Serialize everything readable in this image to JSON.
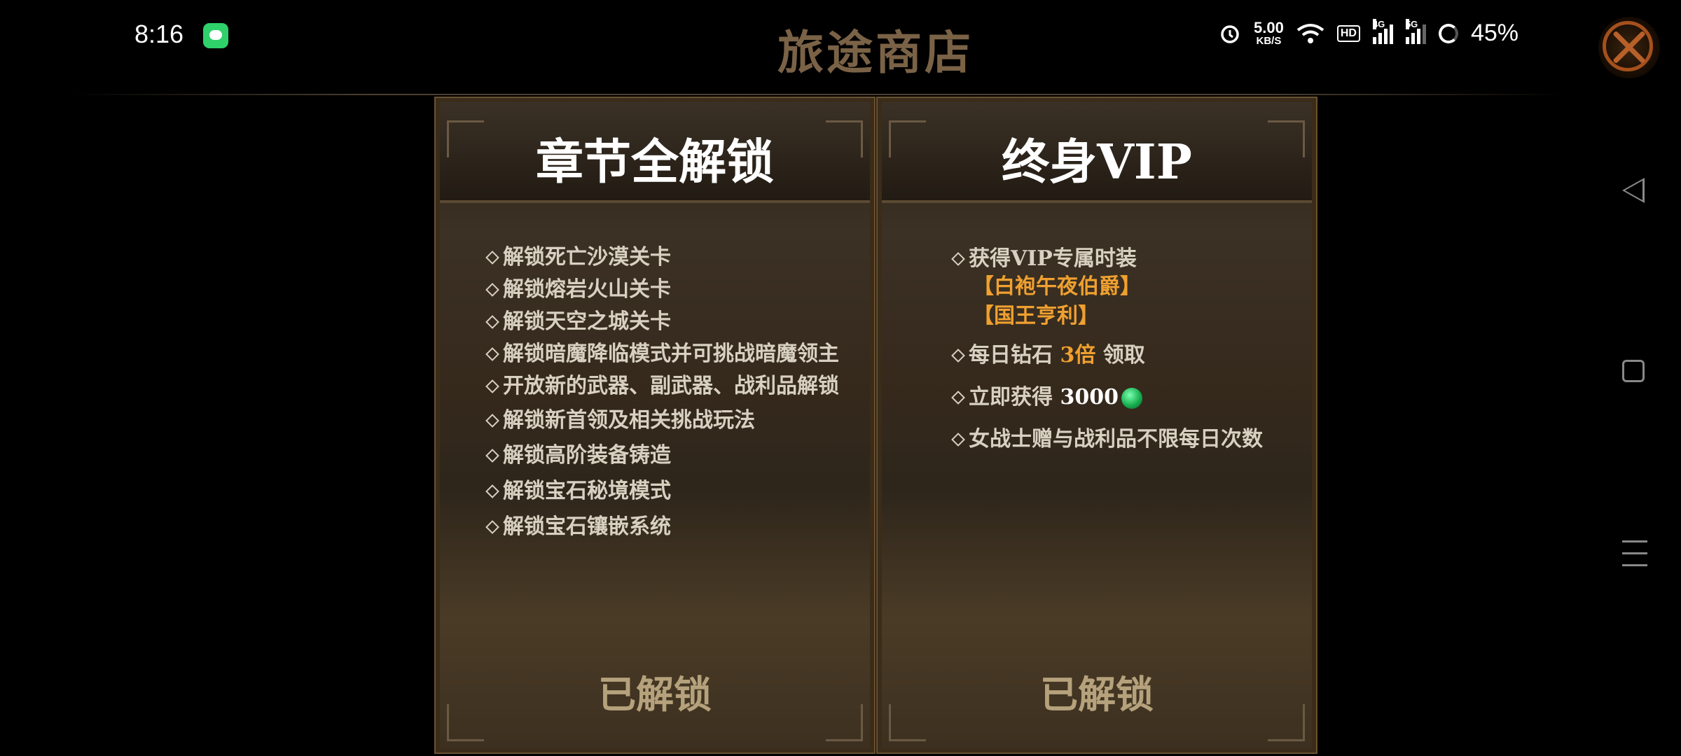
{
  "status_bar": {
    "time": "8:16",
    "net_speed_value": "5.00",
    "net_speed_unit": "KB/S",
    "hd_label": "HD",
    "sim1_label": "4G",
    "sim2_label": "5G",
    "battery": "45%"
  },
  "header": {
    "title": "旅途商店"
  },
  "cards": [
    {
      "title": "章节全解锁",
      "features": [
        "解锁死亡沙漠关卡",
        "解锁熔岩火山关卡",
        "解锁天空之城关卡",
        "解锁暗魔降临模式并可挑战暗魔领主",
        "开放新的武器、副武器、战利品解锁",
        "解锁新首领及相关挑战玩法",
        "解锁高阶装备铸造",
        "解锁宝石秘境模式",
        "解锁宝石镶嵌系统"
      ],
      "button": "已解锁"
    },
    {
      "title": "终身VIP",
      "f1": "获得VIP专属时装",
      "f1_sub1": "【白袍午夜伯爵】",
      "f1_sub2": "【国王亨利】",
      "f2_prefix": "每日钻石 ",
      "f2_highlight": "3倍",
      "f2_suffix": " 领取",
      "f3_prefix": "立即获得 ",
      "f3_amount": "3000",
      "f4": "女战士赠与战利品不限每日次数",
      "button": "已解锁"
    }
  ],
  "icons": [
    "message-icon",
    "alarm-icon",
    "wifi-icon",
    "signal-icon",
    "battery-icon",
    "close-icon",
    "gem-icon",
    "back-nav-icon",
    "home-nav-icon",
    "menu-nav-icon"
  ],
  "colors": {
    "title": "#7a6246",
    "highlight": "#f0a030",
    "button_text": "#b5a27c"
  }
}
